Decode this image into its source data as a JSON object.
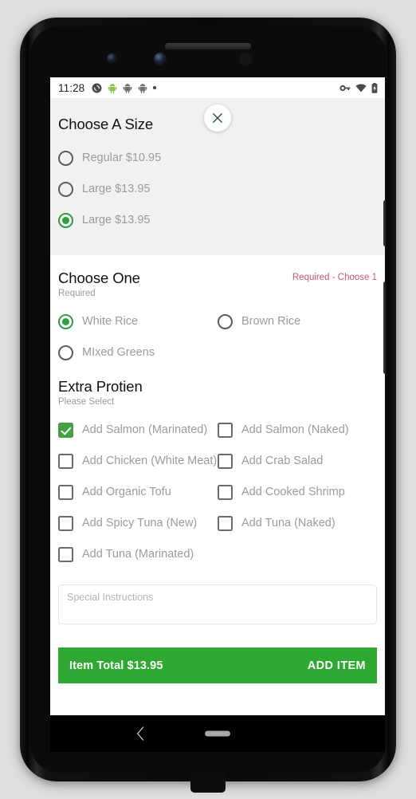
{
  "status_bar": {
    "time": "11:28",
    "left_icons": [
      "sync-icon",
      "android-green-icon",
      "android-gray-icon",
      "android-gray-icon",
      "notification-dot"
    ],
    "right_icons": [
      "vpn-key-icon",
      "wifi-icon",
      "battery-charging-icon"
    ]
  },
  "close_button": {
    "icon": "close-x-icon"
  },
  "size_section": {
    "title": "Choose A Size",
    "options": [
      {
        "label": "Regular $10.95",
        "selected": false
      },
      {
        "label": "Large $13.95",
        "selected": false
      },
      {
        "label": "Large $13.95",
        "selected": true
      }
    ]
  },
  "choose_one_section": {
    "title": "Choose One",
    "subtitle": "Required",
    "required_flag": "Required - Choose 1",
    "required_flag_color": "#c2596a",
    "options": [
      {
        "label": "White Rice",
        "selected": true
      },
      {
        "label": "Brown Rice",
        "selected": false
      },
      {
        "label": "MIxed Greens",
        "selected": false
      }
    ]
  },
  "protein_section": {
    "title": "Extra Protien",
    "subtitle": "Please Select",
    "options": [
      {
        "label": "Add Salmon (Marinated)",
        "checked": true
      },
      {
        "label": "Add Salmon (Naked)",
        "checked": false
      },
      {
        "label": "Add Chicken (White Meat)",
        "checked": false
      },
      {
        "label": "Add Crab Salad",
        "checked": false
      },
      {
        "label": "Add Organic Tofu",
        "checked": false
      },
      {
        "label": "Add Cooked Shrimp",
        "checked": false
      },
      {
        "label": "Add Spicy Tuna (New)",
        "checked": false
      },
      {
        "label": "Add Tuna (Naked)",
        "checked": false
      },
      {
        "label": "Add Tuna (Marinated)",
        "checked": false
      }
    ]
  },
  "special_instructions": {
    "placeholder": "Special Instructions",
    "value": ""
  },
  "add_item_bar": {
    "item_total": "Item Total $13.95",
    "action": "ADD ITEM",
    "background_color": "#2fa832"
  },
  "nav_bar": {
    "back_icon": "chevron-left-icon",
    "home_indicator": "home-pill-indicator"
  },
  "theme": {
    "accent_green": "#2f9e41",
    "checkbox_green": "#43a047",
    "section_gray": "#f1f1f3"
  }
}
